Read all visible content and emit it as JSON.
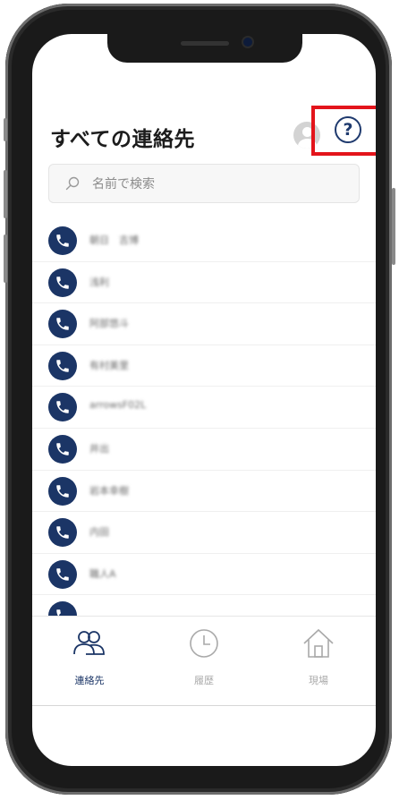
{
  "header": {
    "title": "すべての連絡先",
    "help_symbol": "?"
  },
  "search": {
    "placeholder": "名前で検索"
  },
  "contacts": [
    {
      "name": "朝日　吉博"
    },
    {
      "name": "浅利"
    },
    {
      "name": "阿部悠斗"
    },
    {
      "name": "有村美里"
    },
    {
      "name": "arrowsF02L"
    },
    {
      "name": "井出"
    },
    {
      "name": "岩本幸樹"
    },
    {
      "name": "内田"
    },
    {
      "name": "職人A"
    },
    {
      "name": ""
    }
  ],
  "tabs": [
    {
      "label": "連絡先",
      "icon": "contacts-icon",
      "active": true
    },
    {
      "label": "履歴",
      "icon": "clock-icon",
      "active": false
    },
    {
      "label": "現場",
      "icon": "house-icon",
      "active": false
    }
  ],
  "colors": {
    "accent": "#1b3566",
    "highlight_box": "#e3141b",
    "inactive_tab": "#a9a9a9"
  }
}
